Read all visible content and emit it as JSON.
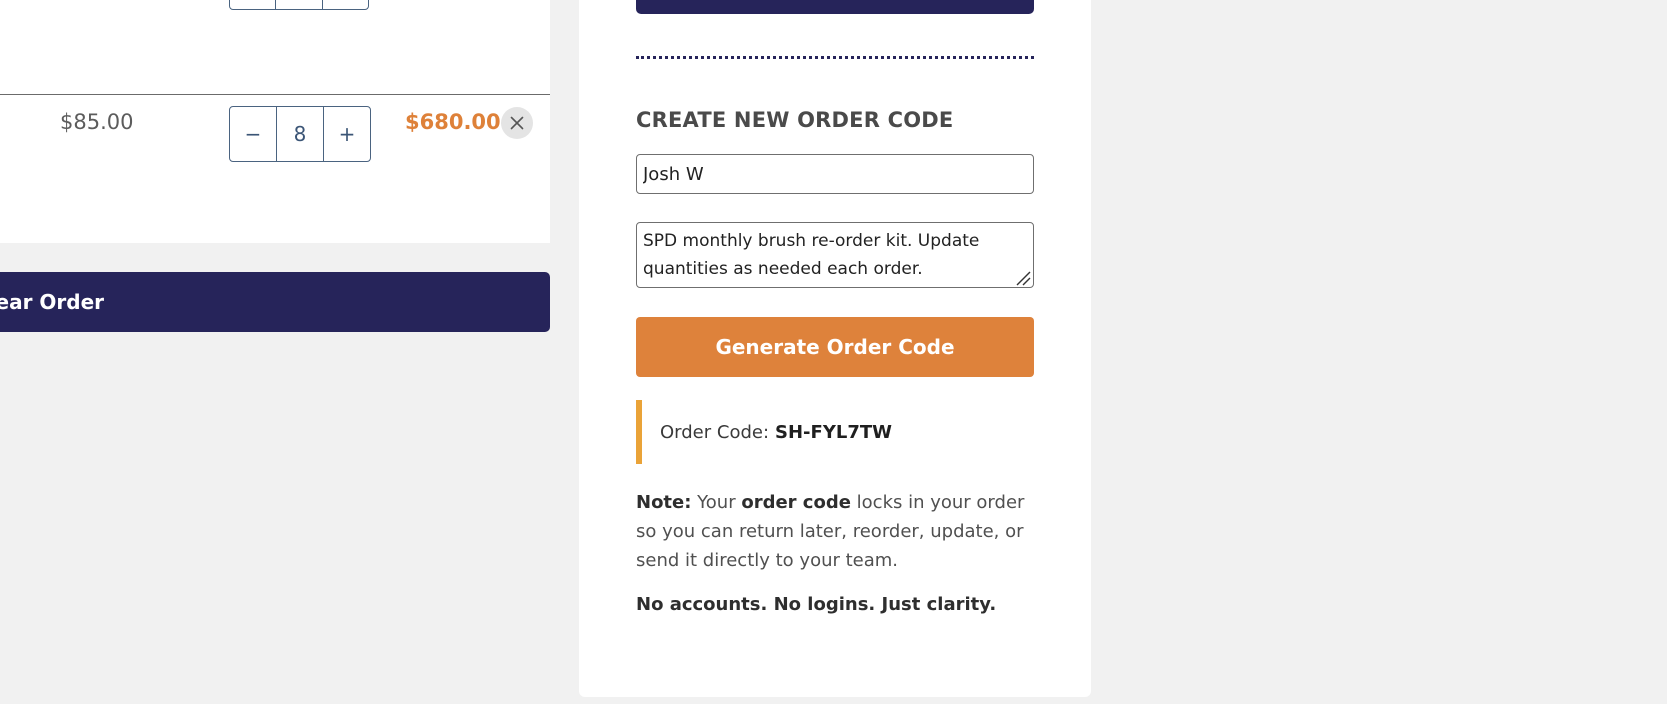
{
  "cart": {
    "row": {
      "unit_price": "$85.00",
      "quantity": "8",
      "decrease_label": "−",
      "increase_label": "+",
      "line_total": "$680.00",
      "remove_icon": "close-icon"
    },
    "clear_button_label": "Clear Order"
  },
  "order_code_panel": {
    "heading": "CREATE NEW ORDER CODE",
    "name_value": "Josh W",
    "notes_value": "SPD monthly brush re-order kit. Update quantities as needed each order.",
    "generate_button_label": "Generate Order Code",
    "order_code_label": "Order Code:",
    "order_code_value": "SH-FYL7TW",
    "note": {
      "lead": "Note:",
      "part1": " Your ",
      "emphasis": "order code",
      "part2": " locks in your order so you can return later, reorder, update, or send it directly to your team."
    },
    "tagline": "No accounts. No logins. Just clarity."
  },
  "colors": {
    "navy": "#26245a",
    "orange": "#de823b",
    "price_orange": "#de8139",
    "callout_border": "#eaa338"
  }
}
